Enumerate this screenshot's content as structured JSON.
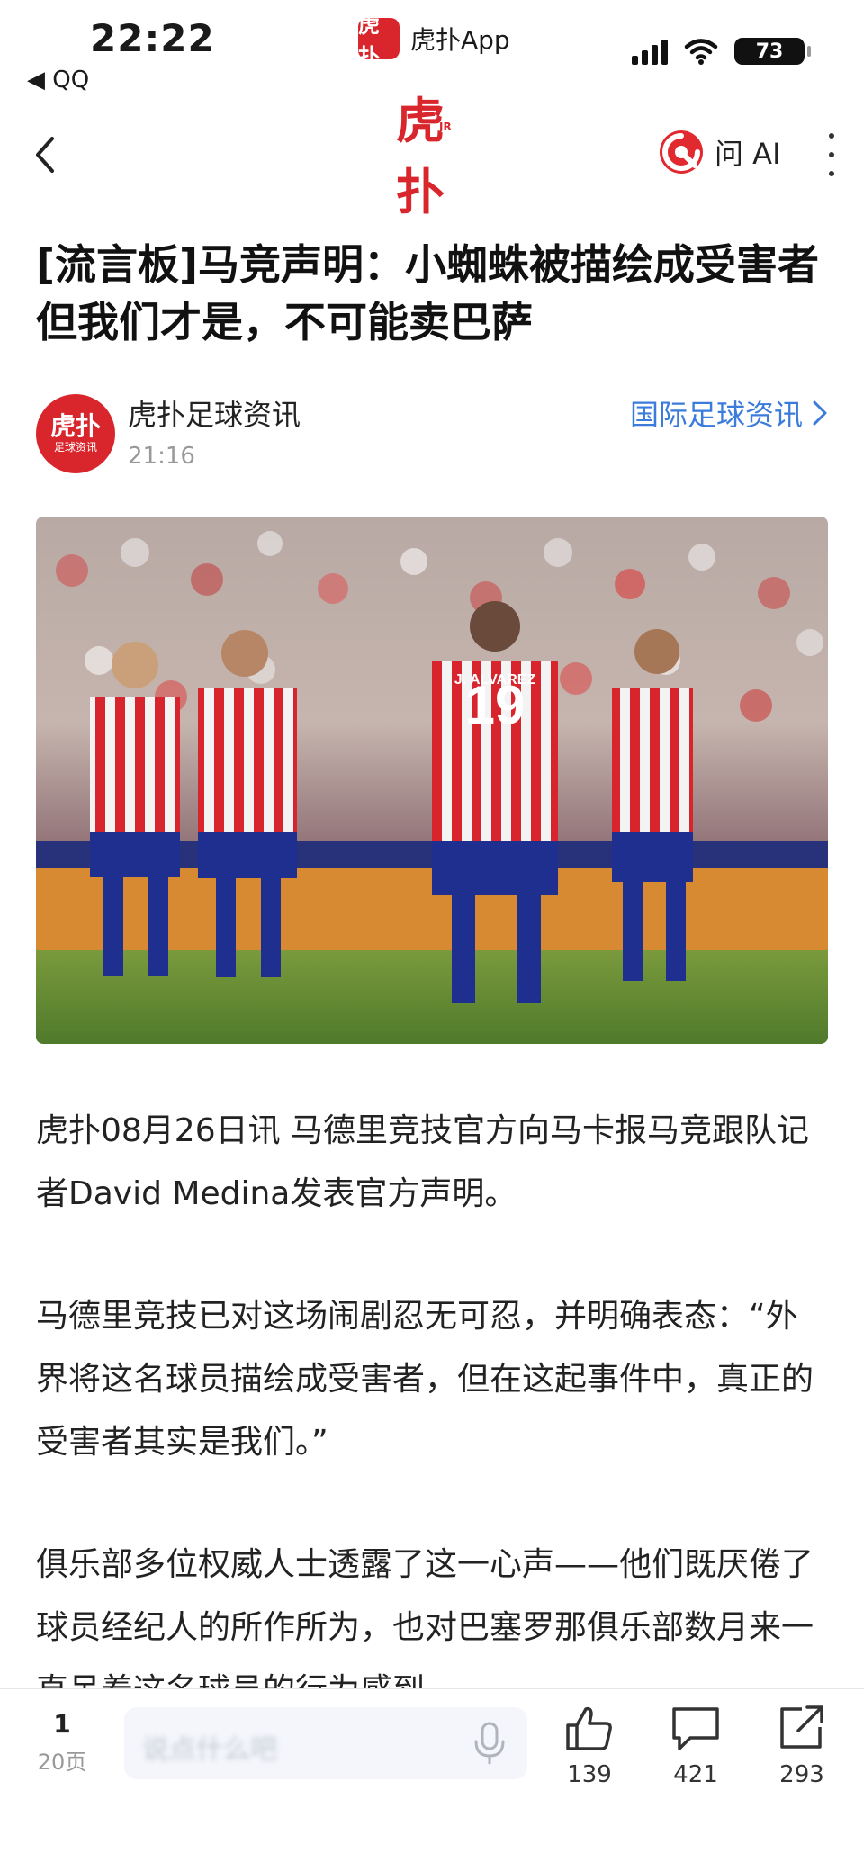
{
  "status_bar": {
    "time": "22:22",
    "back_app": "◀ QQ",
    "app_logo": "虎扑",
    "app_name": "虎扑App",
    "battery": "73"
  },
  "nav": {
    "logo_text": "虎扑",
    "logo_badge": "JR",
    "ask_ai": "问 AI"
  },
  "article": {
    "title": "[流言板]马竞声明：小蜘蛛被描绘成受害者但我们才是，不可能卖巴萨",
    "author": {
      "avatar_big": "虎扑",
      "avatar_small": "足球资讯",
      "name": "虎扑足球资讯",
      "time": "21:16"
    },
    "category": "国际足球资讯",
    "image_jersey_text": "J. ALVAREZ",
    "paragraphs": [
      "虎扑08月26日讯 马德里竞技官方向马卡报马竞跟队记者David Medina发表官方声明。",
      "马德里竞技已对这场闹剧忍无可忍，并明确表态：“外界将这名球员描绘成受害者，但在这起事件中，真正的受害者其实是我们。”",
      "俱乐部多位权威人士透露了这一心声——他们既厌倦了球员经纪人的所作所为，也对巴塞罗那俱乐部数月来一直吊着这名球员的行为感到"
    ]
  },
  "bottom_bar": {
    "page_current": "1",
    "page_total": "20页",
    "comment_placeholder": "说点什么吧",
    "likes": "139",
    "comments": "421",
    "shares": "293"
  },
  "colors": {
    "brand_red": "#d9262c",
    "link_blue": "#3b7bdb"
  },
  "icons": [
    "back-arrow-icon",
    "signal-icon",
    "wifi-icon",
    "ask-ai-logo-icon",
    "more-icon",
    "chevron-right-icon",
    "microphone-icon",
    "thumbs-up-icon",
    "comment-icon",
    "share-icon"
  ]
}
